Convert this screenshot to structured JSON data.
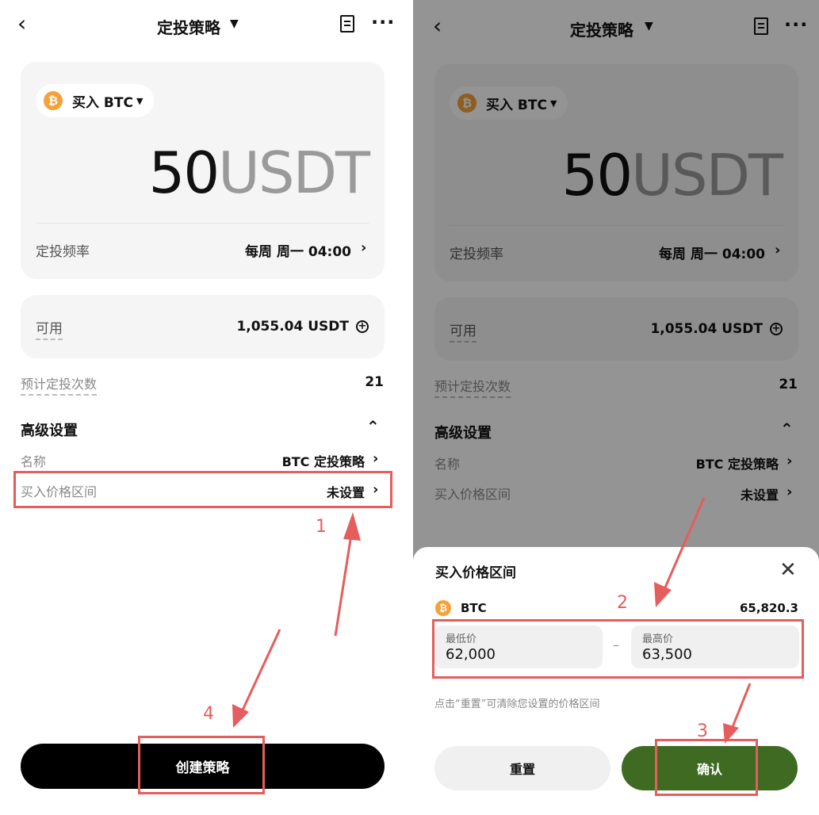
{
  "screen1": {
    "header": {
      "title": "定投策略"
    },
    "buy": {
      "label": "买入 BTC"
    },
    "amount": {
      "value": "50",
      "currency": "USDT"
    },
    "frequency": {
      "label": "定投频率",
      "value": "每周 周一 04:00"
    },
    "available": {
      "label": "可用",
      "value": "1,055.04 USDT"
    },
    "estimate": {
      "label": "预计定投次数",
      "value": "21"
    },
    "advanced": {
      "title": "高级设置"
    },
    "name": {
      "label": "名称",
      "value": "BTC 定投策略"
    },
    "price_range": {
      "label": "买入价格区间",
      "value": "未设置"
    },
    "create_button": "创建策略",
    "steps": {
      "one": "1",
      "four": "4"
    }
  },
  "screen2": {
    "header": {
      "title": "定投策略"
    },
    "buy": {
      "label": "买入 BTC"
    },
    "amount": {
      "value": "50",
      "currency": "USDT"
    },
    "frequency": {
      "label": "定投频率",
      "value": "每周 周一 04:00"
    },
    "available": {
      "label": "可用",
      "value": "1,055.04 USDT"
    },
    "estimate": {
      "label": "预计定投次数",
      "value": "21"
    },
    "advanced": {
      "title": "高级设置"
    },
    "name": {
      "label": "名称",
      "value": "BTC 定投策略"
    },
    "price_range": {
      "label": "买入价格区间",
      "value": "未设置"
    },
    "sheet": {
      "title": "买入价格区间",
      "coin": "BTC",
      "current_price": "65,820.3",
      "min_label": "最低价",
      "min_value": "62,000",
      "dash": "–",
      "max_label": "最高价",
      "max_value": "63,500",
      "hint": "点击“重置”可清除您设置的价格区间",
      "reset_button": "重置",
      "confirm_button": "确认"
    },
    "steps": {
      "two": "2",
      "three": "3"
    }
  },
  "icons": {
    "back": "chevron-left-icon",
    "title_caret": "caret-down-icon",
    "document": "document-icon",
    "more": "more-horizontal-icon",
    "coin": "bitcoin-icon",
    "chevron": "chevron-right-icon",
    "add": "plus-circle-icon",
    "collapse": "chevron-up-icon",
    "close": "close-icon"
  },
  "colors": {
    "bitcoin": "#f5a13a",
    "confirm": "#3f6a22",
    "annotation": "#e55d5d",
    "primary_button": "#000000"
  }
}
